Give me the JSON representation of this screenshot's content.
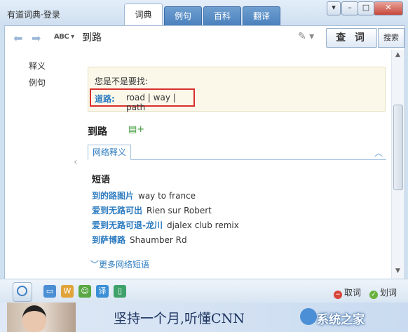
{
  "window": {
    "title": "有道词典·登录",
    "tabs": [
      {
        "label": "词典",
        "active": true
      },
      {
        "label": "例句",
        "active": false
      },
      {
        "label": "百科",
        "active": false
      },
      {
        "label": "翻译",
        "active": false
      }
    ],
    "controls": {
      "minimize": "–",
      "maximize": "□",
      "close": "✕",
      "menu": "▾"
    }
  },
  "toolbar": {
    "back_icon": "⬅",
    "forward_icon": "➡",
    "input_mode": "ABC",
    "query": "到路",
    "query_button": "查 词",
    "search_button": "搜索"
  },
  "sidebar": {
    "items": [
      {
        "label": "释义"
      },
      {
        "label": "例句"
      }
    ]
  },
  "suggestion": {
    "question": "您是不是要找:",
    "word": "道路:",
    "definition": "road | way | path"
  },
  "entry": {
    "headword": "到路",
    "tab_label": "网络释义",
    "section_title": "短语",
    "phrases": [
      {
        "zh": "到的路图片",
        "en": "way to france"
      },
      {
        "zh": "爱到无路可出",
        "en": "Rien sur Robert"
      },
      {
        "zh": "爱到无路可退-龙川",
        "en": "djalex club remix"
      },
      {
        "zh": "到萨博路",
        "en": "Shaumber Rd"
      }
    ],
    "more_link": "更多网络短语"
  },
  "bottombar": {
    "stop_label": "取词",
    "select_label": "划词"
  },
  "banner": {
    "text": "坚持一个月,听懂CNN",
    "watermark": "系统之家"
  }
}
